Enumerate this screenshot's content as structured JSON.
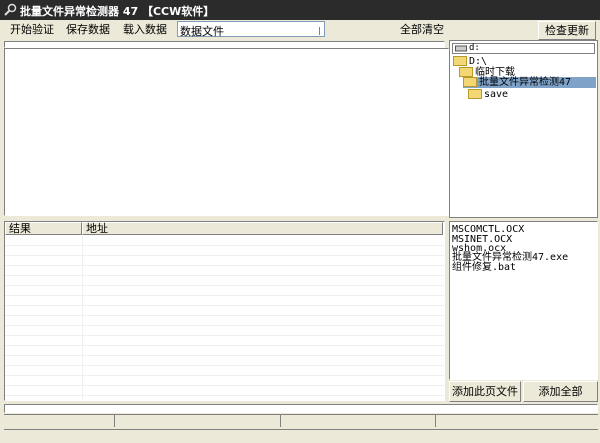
{
  "window": {
    "title": "批量文件异常检测器 47 【CCW软件】"
  },
  "toolbar": {
    "start_label": "开始验证",
    "save_label": "保存数据",
    "load_label": "载入数据",
    "data_file_value": "数据文件",
    "clear_all_label": "全部清空",
    "check_update_label": "检查更新"
  },
  "drive": {
    "value": "d:"
  },
  "tree": {
    "root": "D:\\",
    "items": [
      {
        "label": "临时下载"
      },
      {
        "label": "批量文件异常检测47",
        "selected": true
      },
      {
        "label": "save"
      }
    ]
  },
  "results_table": {
    "col_result": "结果",
    "col_address": "地址",
    "rows": []
  },
  "file_list": {
    "items": [
      "MSCOMCTL.OCX",
      "MSINET.OCX",
      "wshom.ocx",
      "批量文件异常检测47.exe",
      "组件修复.bat"
    ]
  },
  "actions": {
    "add_page_label": "添加此页文件",
    "add_all_label": "添加全部"
  }
}
